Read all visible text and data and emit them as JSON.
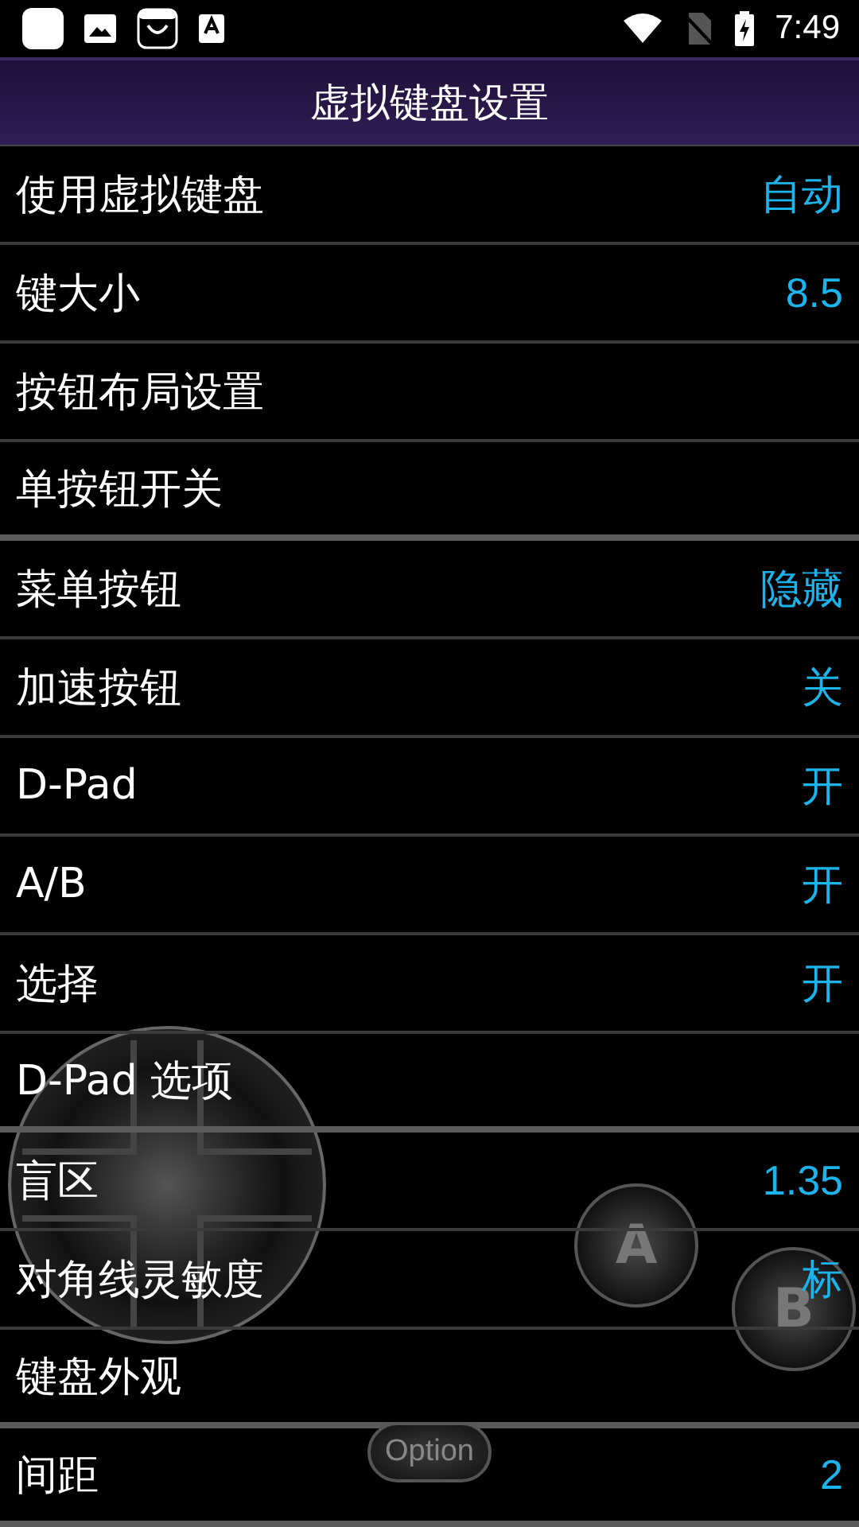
{
  "status_bar": {
    "time": "7:49"
  },
  "title": "虚拟键盘设置",
  "sections": [
    {
      "rows": [
        {
          "label": "使用虚拟键盘",
          "value": "自动"
        },
        {
          "label": "键大小",
          "value": "8.5"
        },
        {
          "label": "按钮布局设置"
        },
        {
          "label": "单按钮开关"
        }
      ]
    },
    {
      "rows": [
        {
          "label": "菜单按钮",
          "value": "隐藏"
        },
        {
          "label": "加速按钮",
          "value": "关"
        },
        {
          "label": "D-Pad",
          "value": "开"
        },
        {
          "label": "A/B",
          "value": "开"
        },
        {
          "label": "选择",
          "value": "开"
        },
        {
          "label": "D-Pad 选项"
        }
      ]
    },
    {
      "rows": [
        {
          "label": "盲区",
          "value": "1.35"
        },
        {
          "label": "对角线灵敏度",
          "value": "标"
        },
        {
          "label": "键盘外观"
        }
      ]
    },
    {
      "rows": [
        {
          "label": "间距",
          "value": "2"
        }
      ]
    }
  ],
  "overlay": [
    {
      "kind": "dpad"
    },
    {
      "kind": "round",
      "label": "A"
    },
    {
      "kind": "round",
      "label": "B"
    },
    {
      "kind": "pill",
      "label": "Option"
    }
  ]
}
